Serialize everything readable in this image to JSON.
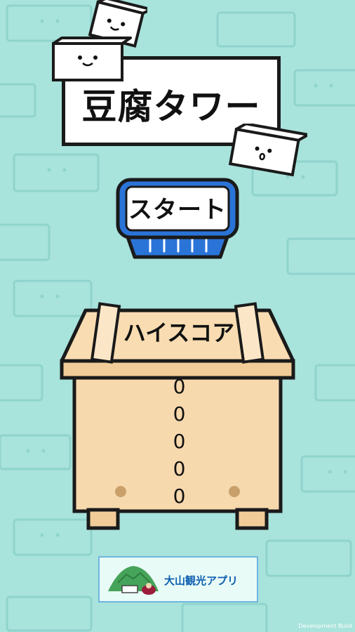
{
  "game": {
    "title": "豆腐タワー",
    "start_label": "スタート",
    "highscore_label": "ハイスコア",
    "highscore_value": "00000",
    "banner_label": "大山観光アプリ",
    "build_label": "Development Build"
  },
  "colors": {
    "background": "#a8e3dc",
    "tofu": "#ffffff",
    "outline": "#1a1a1a",
    "start_tray": "#1f6fd1",
    "box_wood": "#f7d9ae",
    "box_wood_dark": "#e6c08c",
    "banner_text": "#0c5fb0"
  },
  "icons": [
    "tofu-face-icon",
    "mountain-logo-icon"
  ]
}
